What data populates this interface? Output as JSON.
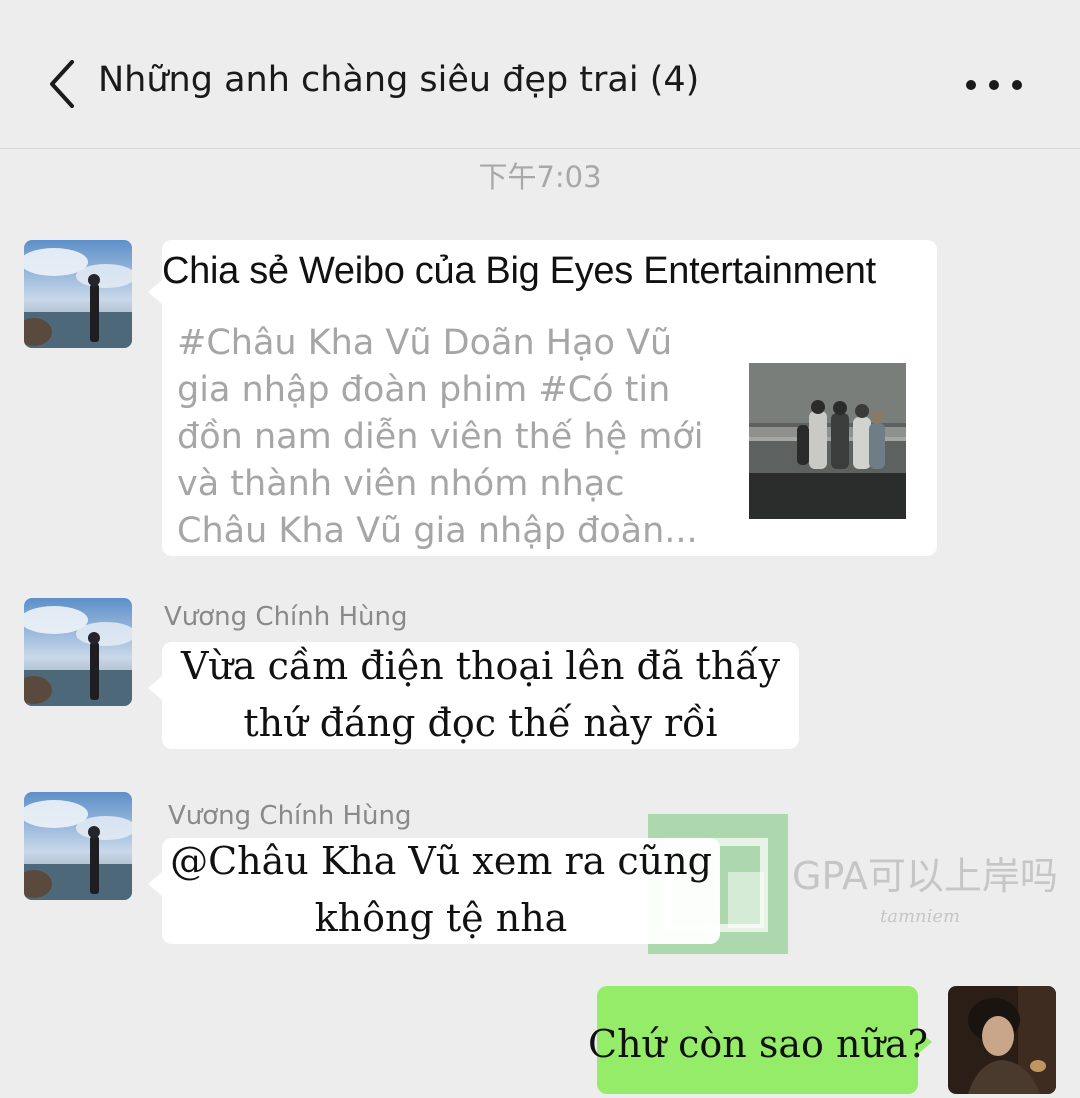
{
  "header": {
    "title": "Những anh chàng siêu đẹp trai (4)",
    "back_icon": "chevron-left-icon",
    "more_icon": "more-dots-icon"
  },
  "chat": {
    "timestamp": "下午7:03",
    "messages": [
      {
        "type": "share-card",
        "card_title": "Chia sẻ Weibo của Big Eyes Entertainment",
        "card_desc_lines": [
          "#Châu Kha Vũ Doãn Hạo Vũ",
          "gia nhập đoàn phim #Có tin",
          "đồn nam diễn viên thế hệ mới",
          "và thành viên nhóm nhạc",
          "Châu Kha Vũ gia nhập đoàn..."
        ]
      },
      {
        "type": "text",
        "sender": "Vương Chính Hùng",
        "lines": [
          "Vừa cầm điện thoại lên đã thấy",
          "thứ đáng đọc thế này rồi"
        ]
      },
      {
        "type": "text",
        "sender": "Vương Chính Hùng",
        "lines": [
          "@Châu Kha Vũ xem ra cũng",
          "không tệ nha"
        ]
      },
      {
        "type": "text-self",
        "lines": [
          "Chứ còn sao nữa?"
        ]
      }
    ]
  },
  "watermark": {
    "text": "GPA可以上岸吗",
    "subtext": "tamniem"
  },
  "colors": {
    "background": "#ededed",
    "bubble_incoming": "#ffffff",
    "bubble_outgoing": "#95ec69",
    "timestamp": "#a8a8a8",
    "sender": "#8a8a8a"
  }
}
